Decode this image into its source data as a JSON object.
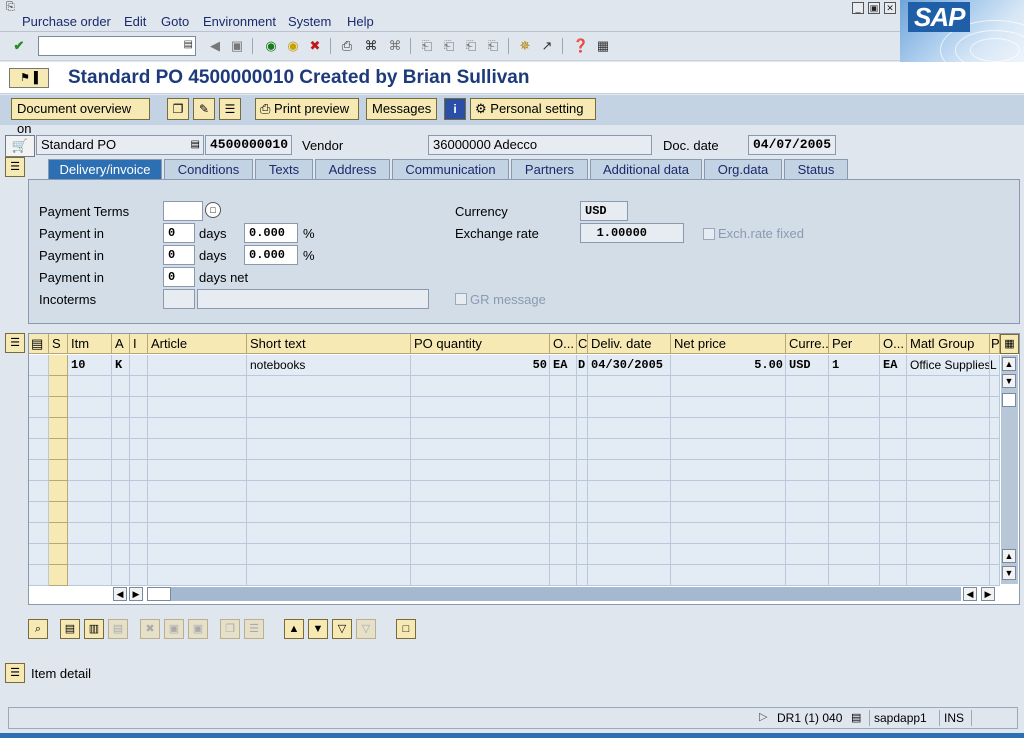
{
  "menu": [
    "Purchase order",
    "Edit",
    "Goto",
    "Environment",
    "System",
    "Help"
  ],
  "brand": "SAP",
  "window_controls": [
    "minimize",
    "maximize",
    "close"
  ],
  "toolbar": {
    "command_field_value": "",
    "icons": [
      "enter-icon",
      "back-icon",
      "save-icon",
      "back-green-icon",
      "exit-icon",
      "cancel-icon",
      "print-icon",
      "find-icon",
      "find-next-icon",
      "first-page-icon",
      "prev-page-icon",
      "next-page-icon",
      "last-page-icon",
      "new-session-icon",
      "shortcut-icon",
      "help-icon",
      "layout-icon"
    ]
  },
  "title": "Standard PO 4500000010 Created by Brian Sullivan",
  "app_toolbar": {
    "doc_overview": "Document overview on",
    "print_preview": "Print preview",
    "messages": "Messages",
    "personal_setting": "Personal setting"
  },
  "header": {
    "doc_type": "Standard PO",
    "po_number": "4500000010",
    "vendor_label": "Vendor",
    "vendor_value": "36000000 Adecco",
    "doc_date_label": "Doc. date",
    "doc_date_value": "04/07/2005"
  },
  "tabs": [
    "Delivery/invoice",
    "Conditions",
    "Texts",
    "Address",
    "Communication",
    "Partners",
    "Additional data",
    "Org.data",
    "Status"
  ],
  "active_tab": "Delivery/invoice",
  "delivery": {
    "payment_terms_label": "Payment Terms",
    "payment_terms_value": "",
    "payment_in_label": "Payment in",
    "row1": {
      "days": "0",
      "days_label": "days",
      "pct": "0.000",
      "pct_sign": "%"
    },
    "row2": {
      "days": "0",
      "days_label": "days",
      "pct": "0.000",
      "pct_sign": "%"
    },
    "row3": {
      "days": "0",
      "days_label": "days net"
    },
    "incoterms_label": "Incoterms",
    "incoterms_value1": "",
    "incoterms_value2": "",
    "currency_label": "Currency",
    "currency_value": "USD",
    "exchange_rate_label": "Exchange rate",
    "exchange_rate_value": "1.00000",
    "exch_fixed_label": "Exch.rate fixed",
    "gr_message_label": "GR message"
  },
  "grid": {
    "columns": [
      "S",
      "Itm",
      "A",
      "I",
      "Article",
      "Short text",
      "PO quantity",
      "O...",
      "C",
      "Deliv. date",
      "Net price",
      "Curre...",
      "Per",
      "O...",
      "Matl Group",
      "P"
    ],
    "rows": [
      {
        "itm": "10",
        "a": "K",
        "i": "",
        "article": "",
        "short_text": "notebooks",
        "qty": "50",
        "ou": "EA",
        "c": "D",
        "deliv_date": "04/30/2005",
        "net_price": "5.00",
        "currency": "USD",
        "per": "1",
        "opu": "EA",
        "matl_group": "Office Supplies",
        "p": "L"
      }
    ]
  },
  "item_detail_label": "Item detail",
  "status": {
    "system": "DR1 (1) 040",
    "server": "sapdapp1",
    "mode": "INS"
  }
}
